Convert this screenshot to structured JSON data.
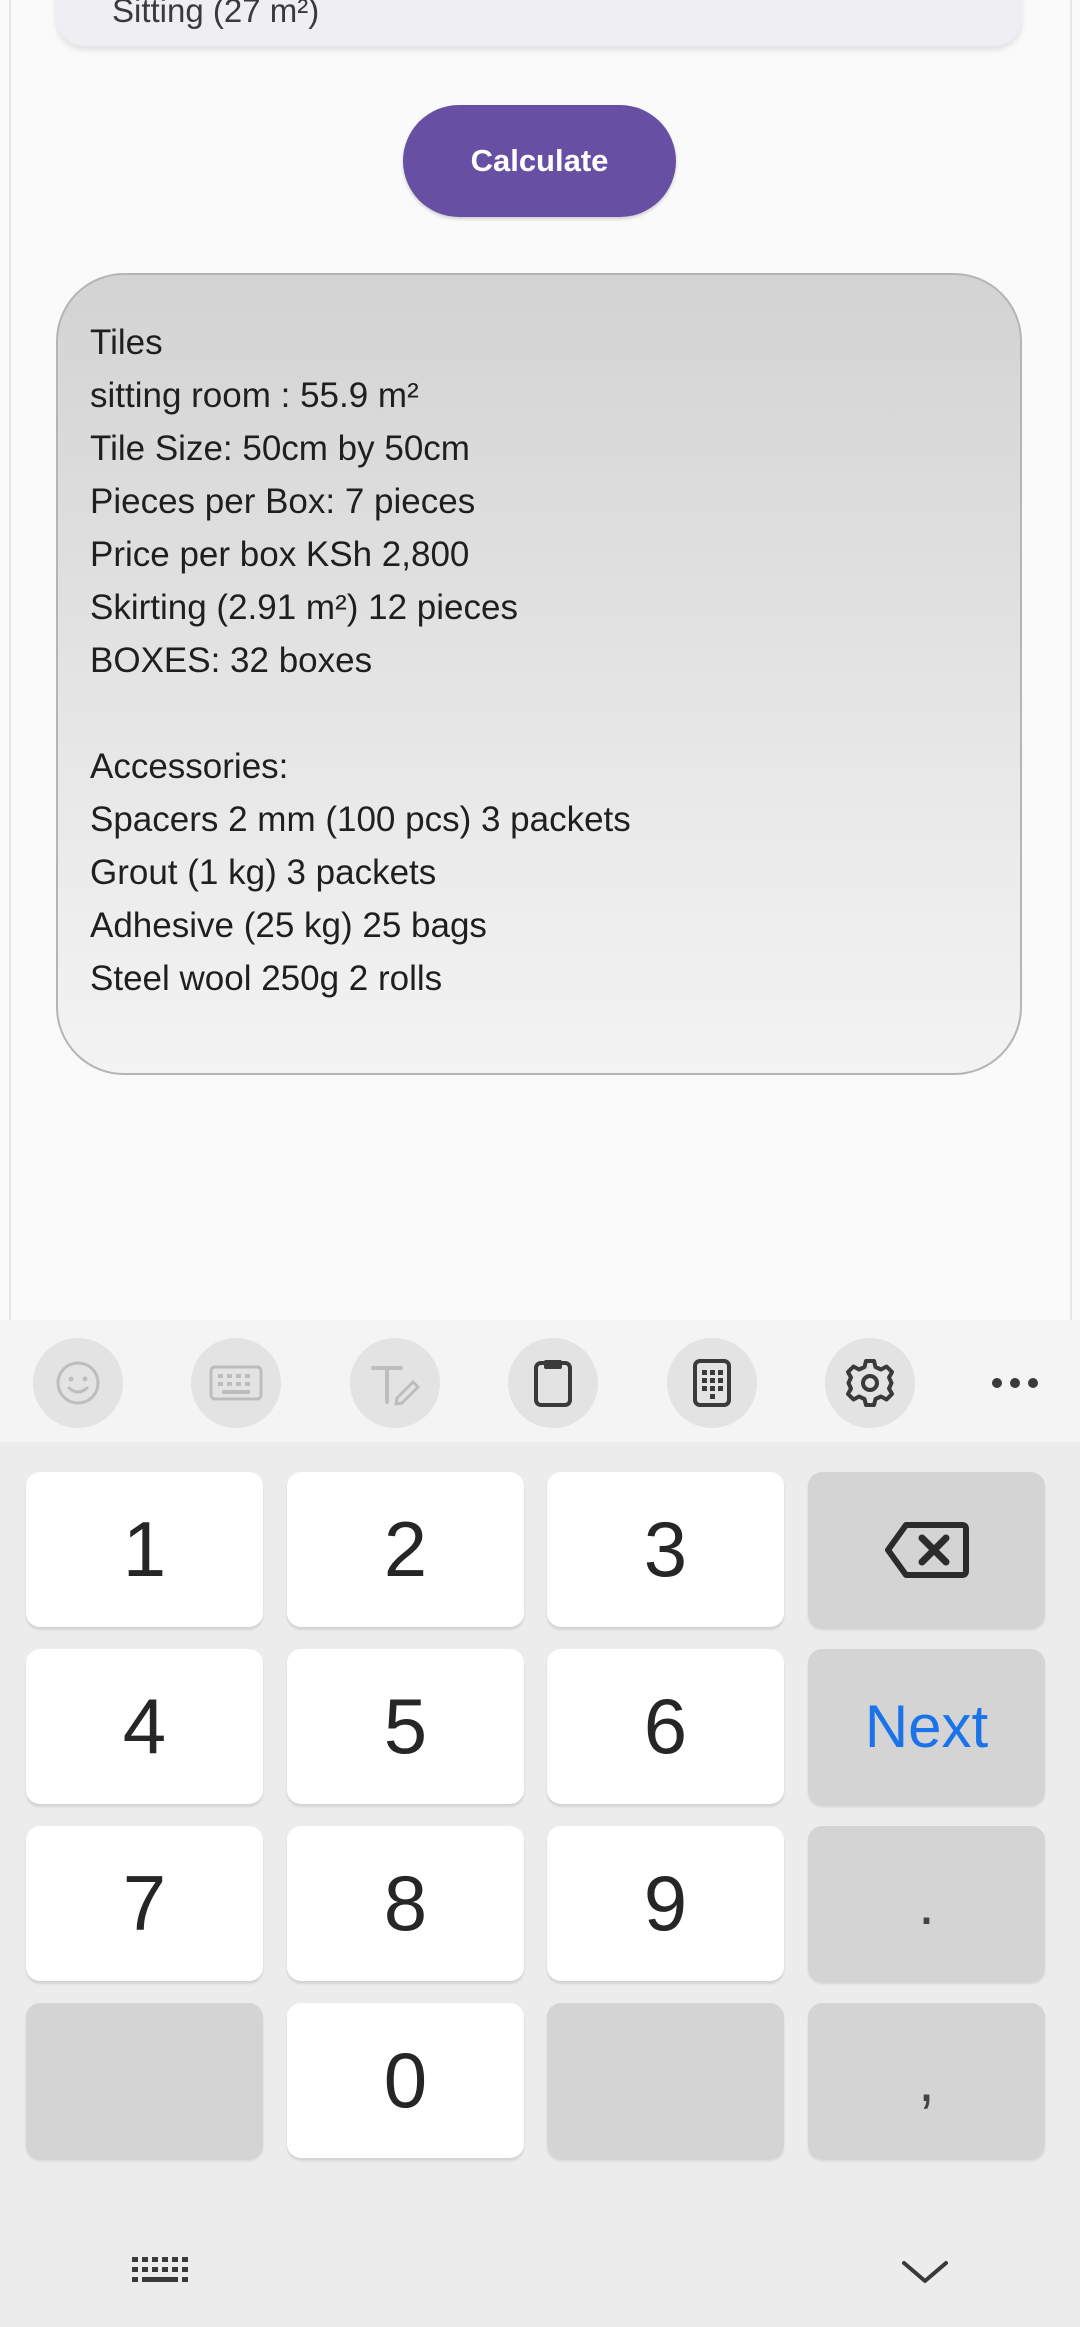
{
  "app": {
    "prev_field_text": "Sitting (27 m²)",
    "calculate_label": "Calculate",
    "result": {
      "lines": [
        "Tiles",
        "sitting room : 55.9 m²",
        "Tile Size: 50cm by 50cm",
        "Pieces per Box: 7 pieces",
        "Price per box KSh 2,800",
        "Skirting (2.91 m²) 12 pieces",
        "BOXES: 32 boxes"
      ],
      "accessories_heading": "Accessories:",
      "accessories": [
        "Spacers 2 mm (100 pcs) 3 packets",
        "Grout (1 kg) 3 packets",
        "Adhesive (25 kg) 25 bags",
        "Steel wool 250g 2 rolls"
      ]
    }
  },
  "keyboard": {
    "toolbar_icons": [
      "emoji-icon",
      "keyboard-icon",
      "handwriting-icon",
      "clipboard-icon",
      "keypad-mode-icon",
      "settings-icon",
      "more-icon"
    ],
    "keys": {
      "k1": "1",
      "k2": "2",
      "k3": "3",
      "k4": "4",
      "k5": "5",
      "k6": "6",
      "k7": "7",
      "k8": "8",
      "k9": "9",
      "k0": "0",
      "next": "Next",
      "dot": ".",
      "comma": ","
    }
  },
  "colors": {
    "accent": "#6750a4",
    "next_key": "#1a73e8"
  }
}
